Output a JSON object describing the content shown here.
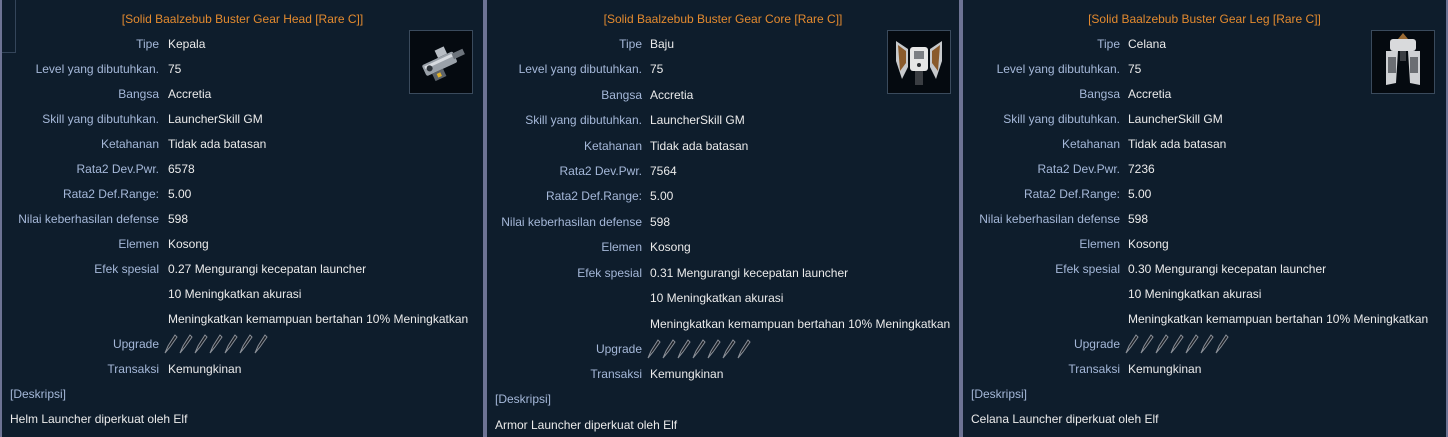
{
  "panels": [
    {
      "title": "[Solid Baalzebub Buster Gear Head [Rare C]]",
      "item_icon": "helm-launcher-icon",
      "rows": [
        {
          "label": "Tipe",
          "value": "Kepala"
        },
        {
          "label": "Level yang dibutuhkan.",
          "value": "75"
        },
        {
          "label": "Bangsa",
          "value": "Accretia"
        },
        {
          "label": "Skill yang dibutuhkan.",
          "value": "LauncherSkill GM"
        },
        {
          "label": "Ketahanan",
          "value": "Tidak ada batasan"
        },
        {
          "label": "Rata2 Dev.Pwr.",
          "value": "6578"
        },
        {
          "label": "Rata2 Def.Range:",
          "value": "5.00"
        },
        {
          "label": "Nilai keberhasilan defense",
          "value": "598"
        },
        {
          "label": "Elemen",
          "value": "Kosong"
        },
        {
          "label": "Efek spesial",
          "value": "0.27 Mengurangi kecepatan launcher"
        },
        {
          "label": "",
          "value": "10 Meningkatkan akurasi"
        },
        {
          "label": "",
          "value": "Meningkatkan kemampuan bertahan 10% Meningkatkan"
        }
      ],
      "upgrade_label": "Upgrade",
      "upgrade_slots": 7,
      "transaksi_label": "Transaksi",
      "transaksi_value": "Kemungkinan",
      "desc_header": "[Deskripsi]",
      "desc_text": "Helm Launcher diperkuat oleh Elf"
    },
    {
      "title": "[Solid Baalzebub Buster Gear Core [Rare C]]",
      "item_icon": "armor-launcher-icon",
      "rows": [
        {
          "label": "Tipe",
          "value": "Baju"
        },
        {
          "label": "Level yang dibutuhkan.",
          "value": "75"
        },
        {
          "label": "Bangsa",
          "value": "Accretia"
        },
        {
          "label": "Skill yang dibutuhkan.",
          "value": "LauncherSkill GM"
        },
        {
          "label": "Ketahanan",
          "value": "Tidak ada batasan"
        },
        {
          "label": "Rata2 Dev.Pwr.",
          "value": "7564"
        },
        {
          "label": "Rata2 Def.Range:",
          "value": "5.00"
        },
        {
          "label": "Nilai keberhasilan defense",
          "value": "598"
        },
        {
          "label": "Elemen",
          "value": "Kosong"
        },
        {
          "label": "Efek spesial",
          "value": "0.31 Mengurangi kecepatan launcher"
        },
        {
          "label": "",
          "value": "10 Meningkatkan akurasi"
        },
        {
          "label": "",
          "value": "Meningkatkan kemampuan bertahan 10% Meningkatkan"
        }
      ],
      "upgrade_label": "Upgrade",
      "upgrade_slots": 7,
      "transaksi_label": "Transaksi",
      "transaksi_value": "Kemungkinan",
      "desc_header": "[Deskripsi]",
      "desc_text": "Armor Launcher diperkuat oleh Elf"
    },
    {
      "title": "[Solid Baalzebub Buster Gear Leg [Rare C]]",
      "item_icon": "leg-launcher-icon",
      "rows": [
        {
          "label": "Tipe",
          "value": "Celana"
        },
        {
          "label": "Level yang dibutuhkan.",
          "value": "75"
        },
        {
          "label": "Bangsa",
          "value": "Accretia"
        },
        {
          "label": "Skill yang dibutuhkan.",
          "value": "LauncherSkill GM"
        },
        {
          "label": "Ketahanan",
          "value": "Tidak ada batasan"
        },
        {
          "label": "Rata2 Dev.Pwr.",
          "value": "7236"
        },
        {
          "label": "Rata2 Def.Range:",
          "value": "5.00"
        },
        {
          "label": "Nilai keberhasilan defense",
          "value": "598"
        },
        {
          "label": "Elemen",
          "value": "Kosong"
        },
        {
          "label": "Efek spesial",
          "value": "0.30 Mengurangi kecepatan launcher"
        },
        {
          "label": "",
          "value": "10 Meningkatkan akurasi"
        },
        {
          "label": "",
          "value": "Meningkatkan kemampuan bertahan 10% Meningkatkan"
        }
      ],
      "upgrade_label": "Upgrade",
      "upgrade_slots": 7,
      "transaksi_label": "Transaksi",
      "transaksi_value": "Kemungkinan",
      "desc_header": "[Deskripsi]",
      "desc_text": "Celana Launcher diperkuat oleh Elf"
    }
  ],
  "colors": {
    "title": "#e38a2f",
    "label": "#a5b8d9",
    "value": "#ebebeb",
    "background": "#0e1d2c",
    "border": "#6d7394"
  }
}
